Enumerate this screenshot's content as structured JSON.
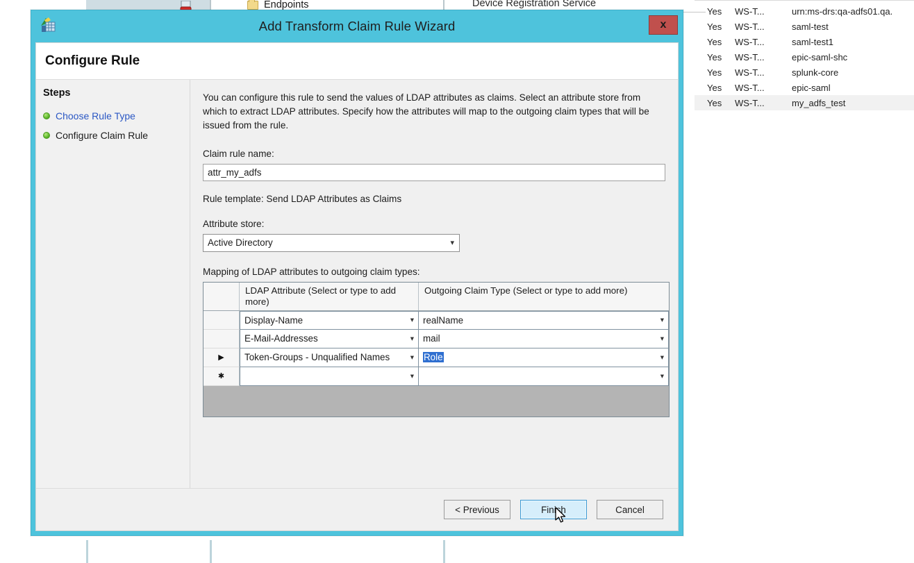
{
  "background": {
    "tree_item_endpoints": "Endpoints",
    "detail_header": "Device Registration Service",
    "list_rows": [
      {
        "enabled": "Yes",
        "type": "WS-T...",
        "identifier": "urn:ms-drs:qa-adfs01.qa.",
        "selected": false
      },
      {
        "enabled": "Yes",
        "type": "WS-T...",
        "identifier": "saml-test",
        "selected": false
      },
      {
        "enabled": "Yes",
        "type": "WS-T...",
        "identifier": "saml-test1",
        "selected": false
      },
      {
        "enabled": "Yes",
        "type": "WS-T...",
        "identifier": "epic-saml-shc",
        "selected": false
      },
      {
        "enabled": "Yes",
        "type": "WS-T...",
        "identifier": "splunk-core",
        "selected": false
      },
      {
        "enabled": "Yes",
        "type": "WS-T...",
        "identifier": "epic-saml",
        "selected": false
      },
      {
        "enabled": "Yes",
        "type": "WS-T...",
        "identifier": "my_adfs_test",
        "selected": true
      }
    ]
  },
  "dialog": {
    "title": "Add Transform Claim Rule Wizard",
    "close_label": "x",
    "page_title": "Configure Rule",
    "accent_color": "#4ec3dc",
    "close_color": "#c0504d"
  },
  "steps": {
    "heading": "Steps",
    "items": [
      {
        "label": "Choose Rule Type",
        "state": "link"
      },
      {
        "label": "Configure Claim Rule",
        "state": "current"
      }
    ]
  },
  "main": {
    "intro": "You can configure this rule to send the values of LDAP attributes as claims. Select an attribute store from which to extract LDAP attributes. Specify how the attributes will map to the outgoing claim types that will be issued from the rule.",
    "claim_rule_name_label": "Claim rule name:",
    "claim_rule_name_value": "attr_my_adfs",
    "claim_rule_name_placeholder": "",
    "rule_template": "Rule template: Send LDAP Attributes as Claims",
    "attribute_store_label": "Attribute store:",
    "attribute_store_value": "Active Directory",
    "attribute_store_options": [
      "Active Directory"
    ],
    "mapping_label": "Mapping of LDAP attributes to outgoing claim types:",
    "grid": {
      "columns": [
        "LDAP Attribute (Select or type to add more)",
        "Outgoing Claim Type (Select or type to add more)"
      ],
      "rows": [
        {
          "marker": "",
          "ldap_attribute": "Display-Name",
          "outgoing_claim_type": "realName",
          "claim_selected": false
        },
        {
          "marker": "",
          "ldap_attribute": "E-Mail-Addresses",
          "outgoing_claim_type": "mail",
          "claim_selected": false
        },
        {
          "marker": "▶",
          "ldap_attribute": "Token-Groups - Unqualified Names",
          "outgoing_claim_type": "Role",
          "claim_selected": true
        },
        {
          "marker": "✱",
          "ldap_attribute": "",
          "outgoing_claim_type": "",
          "claim_selected": false
        }
      ]
    }
  },
  "footer": {
    "previous_label": "< Previous",
    "finish_label": "Finish",
    "cancel_label": "Cancel"
  }
}
